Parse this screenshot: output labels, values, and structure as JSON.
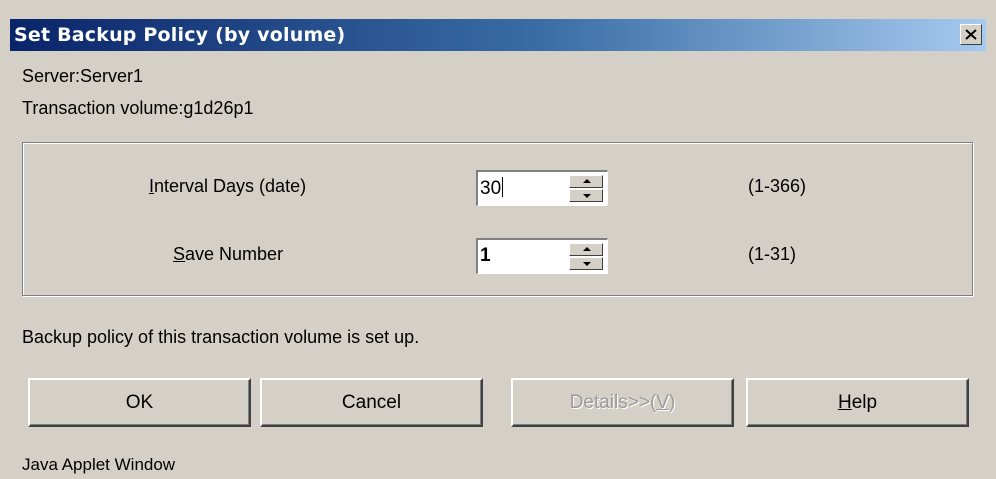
{
  "window": {
    "title": "Set Backup Policy (by volume)",
    "close_label": "×"
  },
  "info": {
    "server": "Server:Server1",
    "transaction_volume": "Transaction volume:g1d26p1"
  },
  "fields": {
    "interval_days": {
      "label_mnemonic": "I",
      "label_rest": "nterval Days (date)",
      "value": "30",
      "range": "(1-366)"
    },
    "save_number": {
      "label_mnemonic": "S",
      "label_rest": "ave Number",
      "value": "1",
      "range": "(1-31)"
    }
  },
  "status_message": "Backup policy of this transaction volume is set up.",
  "buttons": {
    "ok": "OK",
    "cancel": "Cancel",
    "details_prefix": "Details>>(",
    "details_mnemonic": "V",
    "details_suffix": ")",
    "help_mnemonic": "H",
    "help_rest": "elp"
  },
  "footer": "Java Applet Window",
  "colors": {
    "title_gradient_start": "#0a246a",
    "title_gradient_end": "#a6caf0",
    "face": "#d4d0c8"
  }
}
